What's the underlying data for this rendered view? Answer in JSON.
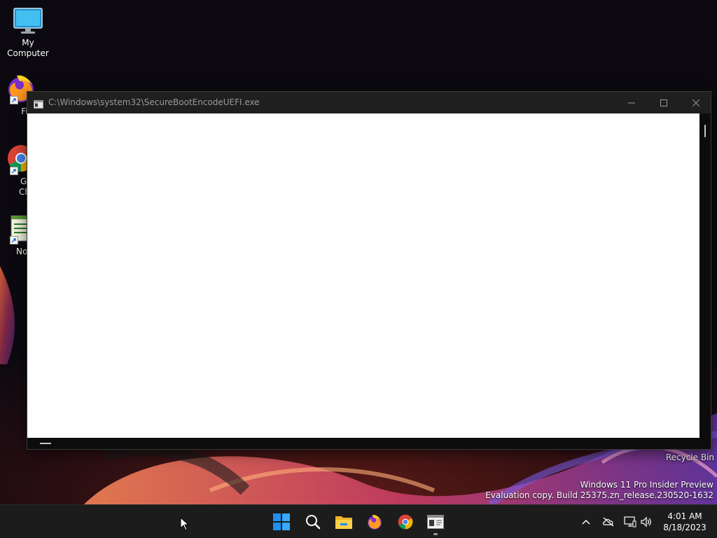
{
  "desktop": {
    "icons": [
      {
        "label": "My Computer"
      },
      {
        "label": "Fire"
      },
      {
        "label": "Goo"
      },
      {
        "label": "Chro"
      },
      {
        "label": "Notep"
      }
    ],
    "recycle_bin_label": "Recycle Bin",
    "watermark": {
      "line1": "Windows 11 Pro Insider Preview",
      "line2": "Evaluation copy. Build 25375.zn_release.230520-1632"
    }
  },
  "window": {
    "title": "C:\\Windows\\system32\\SecureBootEncodeUEFI.exe",
    "controls": {
      "minimize": "minimize",
      "maximize": "maximize",
      "close": "close"
    }
  },
  "taskbar": {
    "apps": [
      "start-icon",
      "search-icon",
      "file-explorer-icon",
      "firefox-icon",
      "chrome-icon",
      "console-app-icon"
    ],
    "tray": [
      "chevron-up-icon",
      "network-offline-icon",
      "display-icon",
      "volume-icon"
    ],
    "clock": {
      "time": "4:01 AM",
      "date": "8/18/2023"
    }
  },
  "colors": {
    "console_bg": "#ffffff",
    "titlebar": "#1f1f1f",
    "taskbar": "#1c1c1c",
    "start_blue": "#1f8ff0"
  }
}
